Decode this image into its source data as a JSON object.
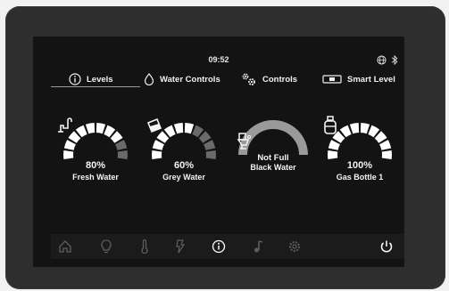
{
  "status": {
    "time": "09:52"
  },
  "tabs": [
    {
      "label": "Levels",
      "icon": "info-icon",
      "active": true
    },
    {
      "label": "Water Controls",
      "icon": "water-drop-icon"
    },
    {
      "label": "Controls",
      "icon": "gears-icon"
    },
    {
      "label": "Smart Level",
      "icon": "level-icon"
    }
  ],
  "gauges": [
    {
      "value": "80%",
      "label": "Fresh Water",
      "icon": "tap-icon",
      "fill_fraction": 0.8
    },
    {
      "value": "60%",
      "label": "Grey Water",
      "icon": "bucket-icon",
      "fill_fraction": 0.6
    },
    {
      "value": "Not Full",
      "label": "Black Water",
      "icon": "toilet-icon",
      "fill_fraction": 1.0
    },
    {
      "value": "100%",
      "label": "Gas Bottle 1",
      "icon": "gas-bottle-icon",
      "fill_fraction": 1.0
    }
  ],
  "bottom_nav": [
    "home-icon",
    "bulb-icon",
    "thermometer-icon",
    "power-bolt-icon",
    "info-icon",
    "music-icon",
    "settings-icon",
    "power-icon"
  ],
  "colors": {
    "accent": "#ffffff",
    "dim": "#6a6a6a",
    "arc": "#9a9a9a",
    "background": "#131313"
  }
}
